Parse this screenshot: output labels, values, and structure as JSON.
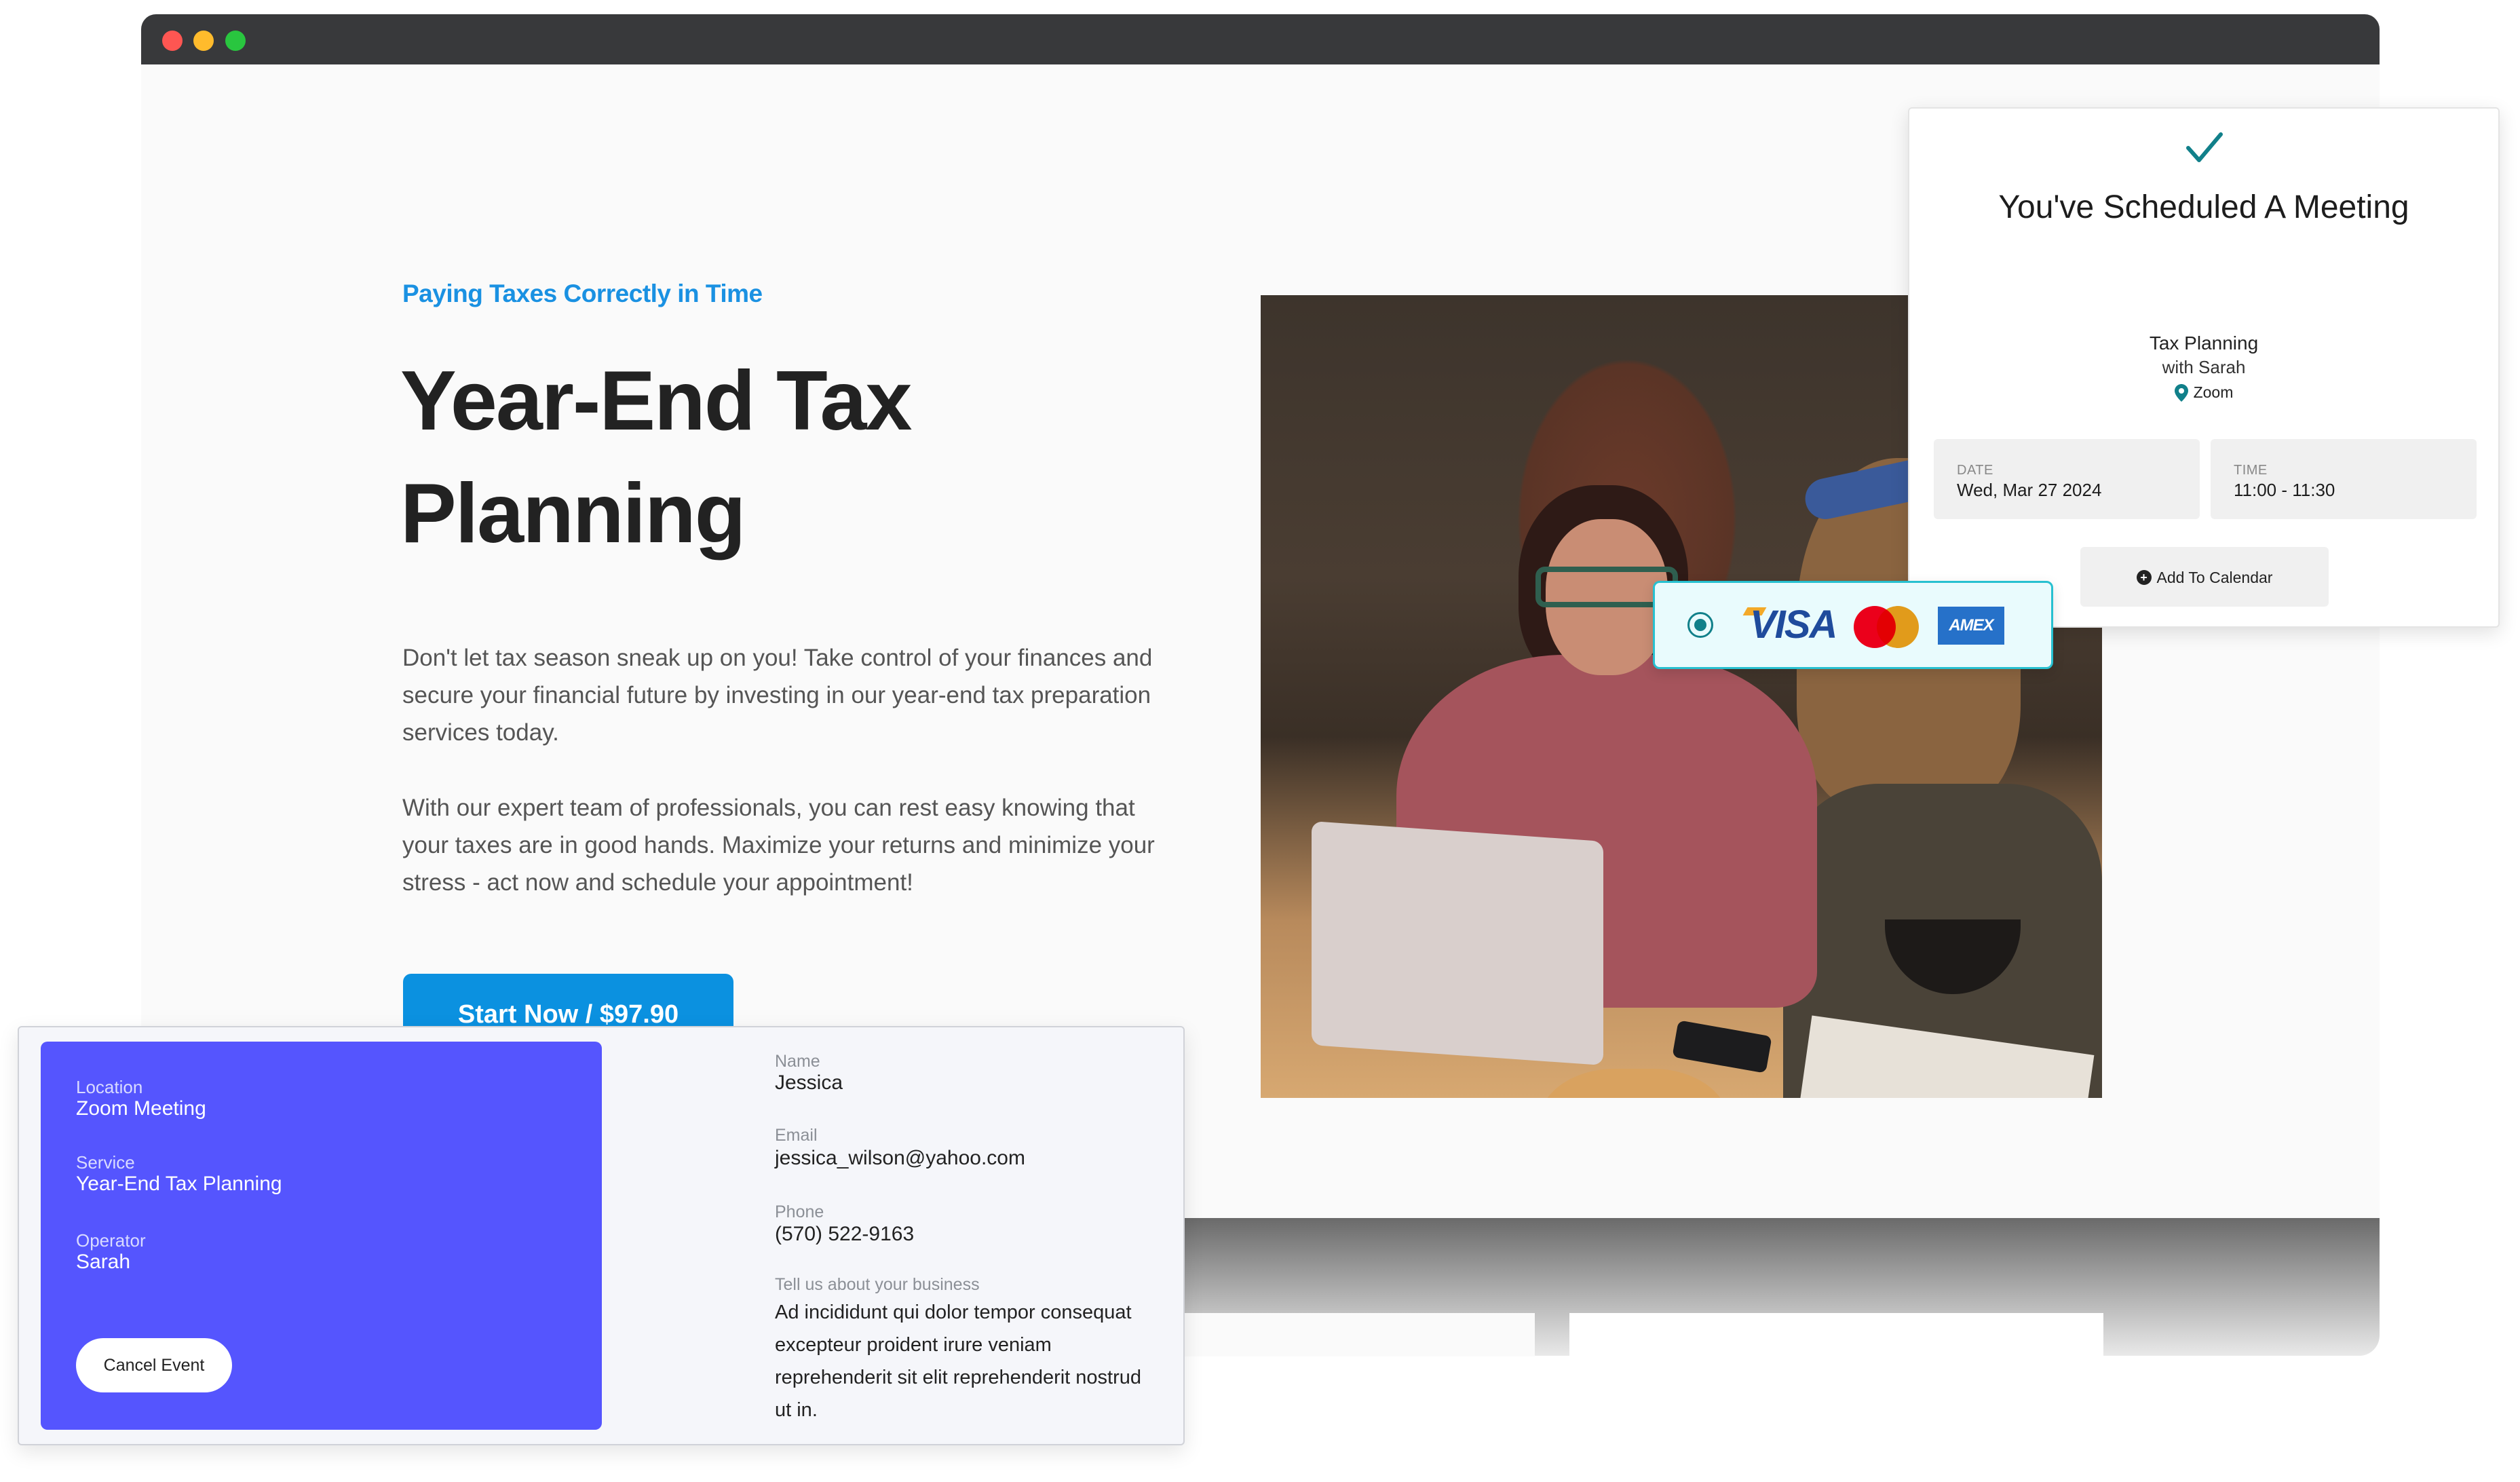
{
  "browser": {
    "controls": [
      "close",
      "minimize",
      "maximize"
    ]
  },
  "hero": {
    "eyebrow": "Paying Taxes Correctly in Time",
    "title": "Year-End Tax Planning",
    "paragraphs": [
      "Don't let tax season sneak up on you! Take control of your finances and secure your financial future by investing in our year-end tax preparation services today.",
      "With our expert team of professionals, you can rest easy knowing that your taxes are in good hands. Maximize your returns and minimize your stress - act now and schedule your appointment!"
    ],
    "cta_label": "Start Now / $97.90"
  },
  "payment": {
    "selected": true,
    "brands": [
      "VISA",
      "mastercard",
      "AMEX"
    ],
    "visa_label": "VISA",
    "amex_label": "AMEX"
  },
  "confirmation": {
    "icon": "check-icon",
    "title": "You've Scheduled A Meeting",
    "service": "Tax Planning",
    "with": "with Sarah",
    "location": "Zoom",
    "date_label": "DATE",
    "date_value": "Wed, Mar 27 2024",
    "time_label": "TIME",
    "time_value": "11:00 - 11:30",
    "add_calendar_label": "Add To Calendar",
    "accent_color": "#11808a"
  },
  "booking": {
    "summary": [
      {
        "label": "Location",
        "value": "Zoom Meeting"
      },
      {
        "label": "Service",
        "value": "Year-End Tax Planning"
      },
      {
        "label": "Operator",
        "value": "Sarah"
      }
    ],
    "cancel_label": "Cancel Event",
    "fields": [
      {
        "label": "Name",
        "value": "Jessica"
      },
      {
        "label": "Email",
        "value": "jessica_wilson@yahoo.com"
      },
      {
        "label": "Phone",
        "value": "(570) 522-9163"
      },
      {
        "label": "Tell us about your business",
        "value": "Ad incididunt qui dolor tempor consequat excepteur proident irure veniam reprehenderit sit elit reprehenderit nostrud ut in."
      }
    ],
    "panel_color": "#5555fe"
  },
  "colors": {
    "brand_blue": "#0b91e0",
    "eyebrow_blue": "#1a91e2",
    "titlebar": "#38393b"
  }
}
